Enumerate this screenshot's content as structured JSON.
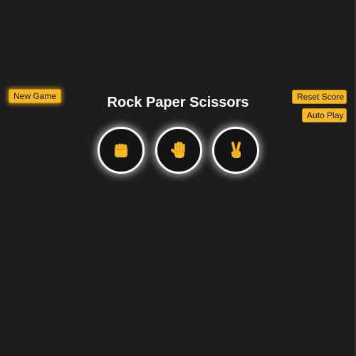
{
  "controls": {
    "new_game_label": "New Game",
    "reset_score_label": "Reset Score",
    "auto_play_label": "Auto Play"
  },
  "game": {
    "title": "Rock Paper Scissors",
    "choices": [
      {
        "id": "rock",
        "icon": "fist-icon"
      },
      {
        "id": "paper",
        "icon": "open-hand-icon"
      },
      {
        "id": "scissors",
        "icon": "victory-hand-icon"
      }
    ]
  },
  "colors": {
    "background": "#1d1d1d",
    "button": "#f8b824",
    "hand": "#f7b928",
    "ring": "#ffffff"
  }
}
